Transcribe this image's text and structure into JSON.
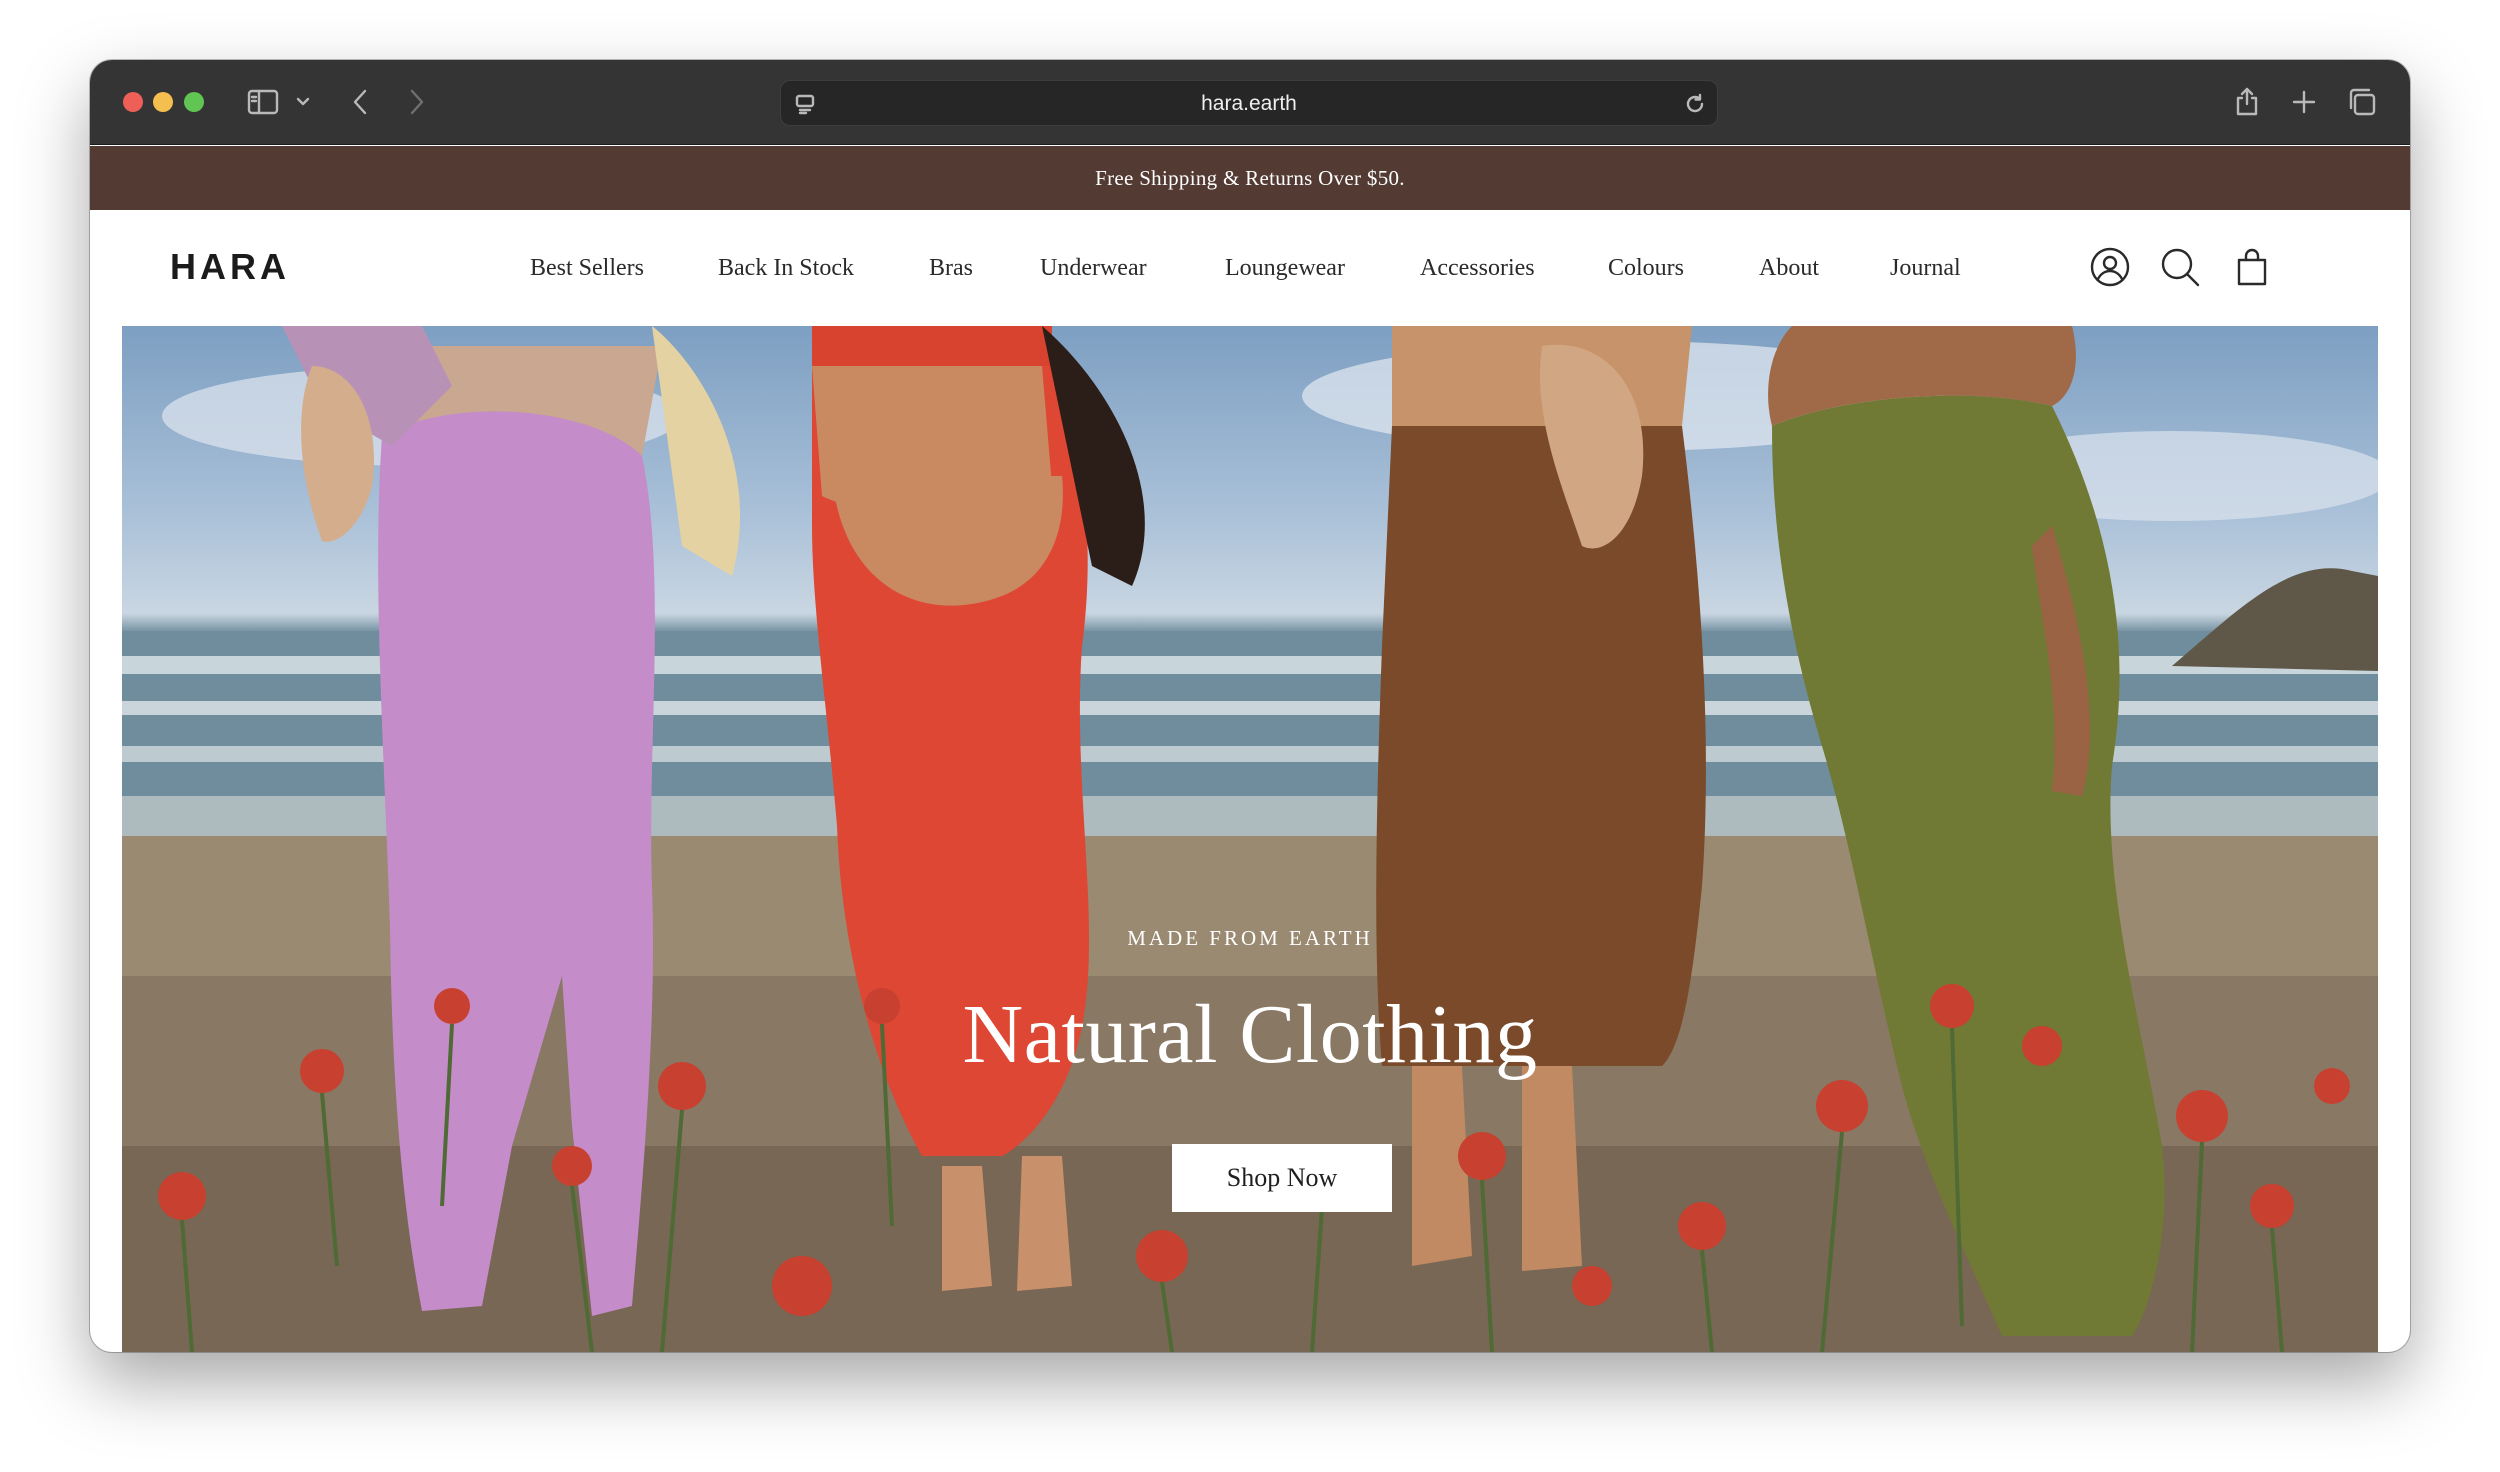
{
  "browser": {
    "url": "hara.earth",
    "icons": [
      "sidebar-icon",
      "chevron-down-icon",
      "back-icon",
      "forward-icon",
      "site-settings-icon",
      "reload-icon",
      "share-icon",
      "new-tab-icon",
      "tabs-overview-icon"
    ]
  },
  "announcement": {
    "text": "Free Shipping & Returns Over $50."
  },
  "header": {
    "logo": "HARA",
    "nav": [
      {
        "label": "Best Sellers"
      },
      {
        "label": "Back In Stock"
      },
      {
        "label": "Bras"
      },
      {
        "label": "Underwear"
      },
      {
        "label": "Loungewear"
      },
      {
        "label": "Accessories"
      },
      {
        "label": "Colours"
      },
      {
        "label": "About"
      },
      {
        "label": "Journal"
      }
    ],
    "icons": [
      "account-icon",
      "search-icon",
      "cart-icon"
    ]
  },
  "hero": {
    "eyebrow": "MADE FROM EARTH",
    "title": "Natural Clothing",
    "cta": "Shop Now"
  },
  "colors": {
    "announcement_bg": "#533a33",
    "chrome_bg": "#343434",
    "lilac": "#c48cc8",
    "red": "#de4733",
    "brown": "#7a4a2a",
    "olive": "#717a34"
  }
}
